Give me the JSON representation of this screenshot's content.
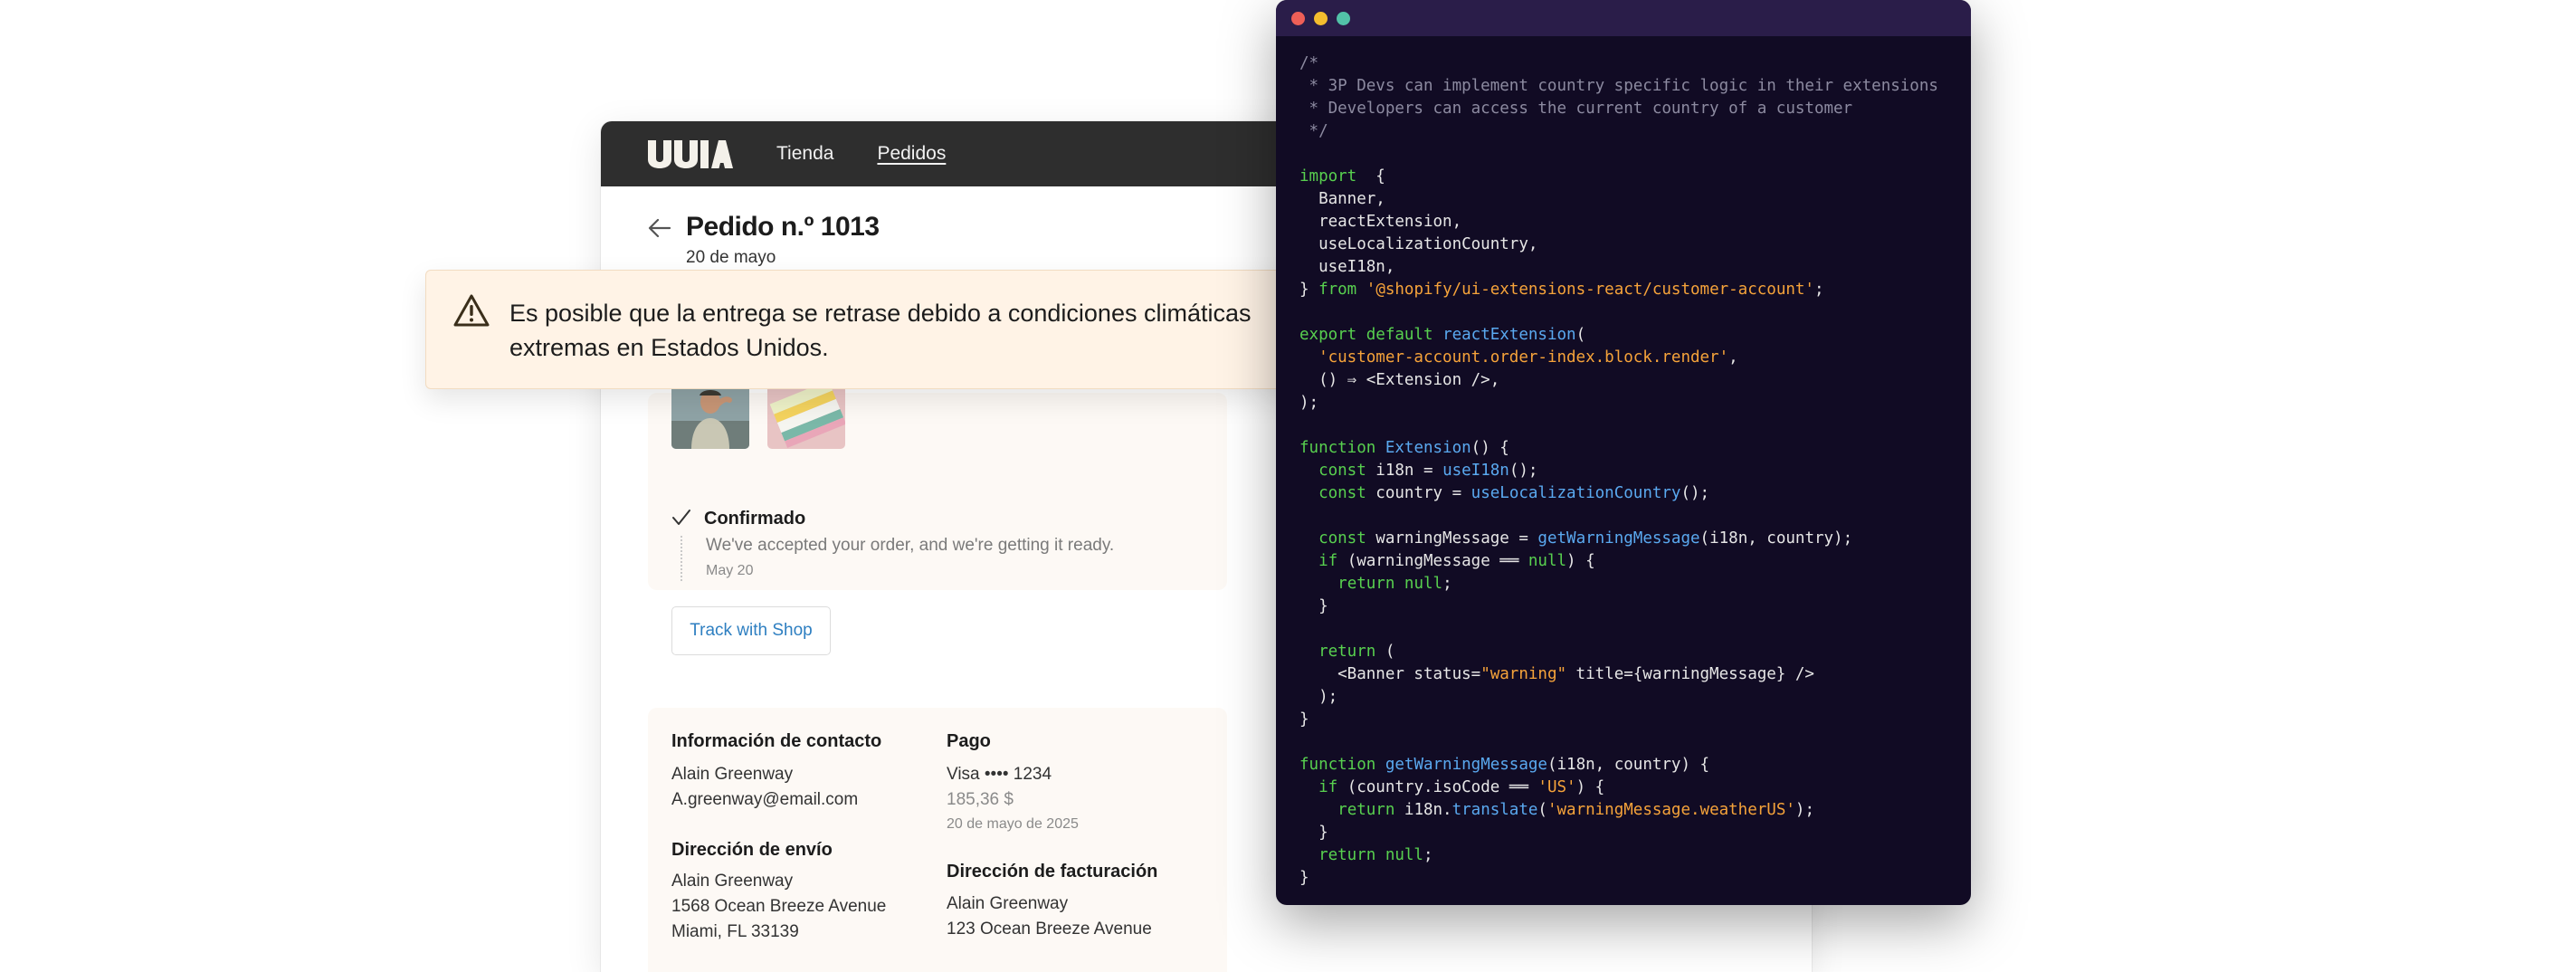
{
  "store": {
    "nav": {
      "shop": "Tienda",
      "orders": "Pedidos"
    },
    "order": {
      "title": "Pedido n.º 1013",
      "date": "20 de mayo"
    },
    "status": {
      "label": "Confirmado",
      "description": "We've accepted your order, and we're getting it ready.",
      "date": "May 20"
    },
    "track_button": "Track with Shop",
    "contact": {
      "heading": "Información de contacto",
      "name": "Alain Greenway",
      "email": "A.greenway@email.com"
    },
    "payment": {
      "heading": "Pago",
      "card": "Visa •••• 1234",
      "amount": "185,36 $",
      "date": "20 de mayo de 2025"
    },
    "shipping": {
      "heading": "Dirección de envío",
      "name": "Alain Greenway",
      "line1": "1568 Ocean Breeze Avenue",
      "line2": "Miami, FL 33139"
    },
    "billing": {
      "heading": "Dirección de facturación",
      "name": "Alain Greenway",
      "line1": "123 Ocean Breeze Avenue"
    }
  },
  "banner": {
    "icon": "warning-icon",
    "text": "Es posible que la entrega se retrase debido a condiciones climáticas extremas en Estados Unidos."
  },
  "colors": {
    "header_bg": "#2e2e2e",
    "banner_bg": "#fff3e6",
    "code_bg": "#110b24",
    "code_comment": "#8c8aa0",
    "code_keyword": "#58d04f",
    "code_function": "#5aa9f0",
    "code_string": "#f6a33a",
    "link_blue": "#2e7fc1"
  },
  "code": {
    "lines": [
      [
        [
          "cmt",
          "/*"
        ]
      ],
      [
        [
          "cmt",
          " * 3P Devs can implement country specific logic in their extensions"
        ]
      ],
      [
        [
          "cmt",
          " * Developers can access the current country of a customer"
        ]
      ],
      [
        [
          "cmt",
          " */"
        ]
      ],
      [],
      [
        [
          "kw",
          "import"
        ],
        [
          "",
          "  {"
        ]
      ],
      [
        [
          "",
          "  Banner,"
        ]
      ],
      [
        [
          "",
          "  reactExtension,"
        ]
      ],
      [
        [
          "",
          "  useLocalizationCountry,"
        ]
      ],
      [
        [
          "",
          "  useI18n,"
        ]
      ],
      [
        [
          "",
          "} "
        ],
        [
          "kw",
          "from"
        ],
        [
          "",
          " "
        ],
        [
          "str",
          "'@shopify/ui-extensions-react/customer-account'"
        ],
        [
          "",
          ";"
        ]
      ],
      [],
      [
        [
          "kw",
          "export default"
        ],
        [
          "",
          " "
        ],
        [
          "fn",
          "reactExtension"
        ],
        [
          "",
          "("
        ]
      ],
      [
        [
          "",
          "  "
        ],
        [
          "str",
          "'customer-account.order-index.block.render'"
        ],
        [
          "",
          ","
        ]
      ],
      [
        [
          "",
          "  () ⇒ <Extension />,"
        ]
      ],
      [
        [
          "",
          ");"
        ]
      ],
      [],
      [
        [
          "kw",
          "function"
        ],
        [
          "",
          " "
        ],
        [
          "fn",
          "Extension"
        ],
        [
          "",
          "() {"
        ]
      ],
      [
        [
          "",
          "  "
        ],
        [
          "kw",
          "const"
        ],
        [
          "",
          " i18n = "
        ],
        [
          "fn",
          "useI18n"
        ],
        [
          "",
          "();"
        ]
      ],
      [
        [
          "",
          "  "
        ],
        [
          "kw",
          "const"
        ],
        [
          "",
          " country = "
        ],
        [
          "fn",
          "useLocalizationCountry"
        ],
        [
          "",
          "();"
        ]
      ],
      [],
      [
        [
          "",
          "  "
        ],
        [
          "kw",
          "const"
        ],
        [
          "",
          " warningMessage = "
        ],
        [
          "fn",
          "getWarningMessage"
        ],
        [
          "",
          "(i18n, country);"
        ]
      ],
      [
        [
          "",
          "  "
        ],
        [
          "kw",
          "if"
        ],
        [
          "",
          " (warningMessage ══ "
        ],
        [
          "kw",
          "null"
        ],
        [
          "",
          ") {"
        ]
      ],
      [
        [
          "",
          "    "
        ],
        [
          "kw",
          "return null"
        ],
        [
          "",
          ";"
        ]
      ],
      [
        [
          "",
          "  }"
        ]
      ],
      [],
      [
        [
          "",
          "  "
        ],
        [
          "kw",
          "return"
        ],
        [
          "",
          " ("
        ]
      ],
      [
        [
          "",
          "    <Banner status="
        ],
        [
          "str",
          "\"warning\""
        ],
        [
          "",
          " title={warningMessage} />"
        ]
      ],
      [
        [
          "",
          "  );"
        ]
      ],
      [
        [
          "",
          "}"
        ]
      ],
      [],
      [
        [
          "kw",
          "function"
        ],
        [
          "",
          " "
        ],
        [
          "fn",
          "getWarningMessage"
        ],
        [
          "",
          "(i18n, country) {"
        ]
      ],
      [
        [
          "",
          "  "
        ],
        [
          "kw",
          "if"
        ],
        [
          "",
          " (country.isoCode ══ "
        ],
        [
          "str",
          "'US'"
        ],
        [
          "",
          ") {"
        ]
      ],
      [
        [
          "",
          "    "
        ],
        [
          "kw",
          "return"
        ],
        [
          "",
          " i18n."
        ],
        [
          "fn",
          "translate"
        ],
        [
          "",
          "("
        ],
        [
          "str",
          "'warningMessage.weatherUS'"
        ],
        [
          "",
          ");"
        ]
      ],
      [
        [
          "",
          "  }"
        ]
      ],
      [
        [
          "",
          "  "
        ],
        [
          "kw",
          "return null"
        ],
        [
          "",
          ";"
        ]
      ],
      [
        [
          "",
          "}"
        ]
      ]
    ]
  }
}
